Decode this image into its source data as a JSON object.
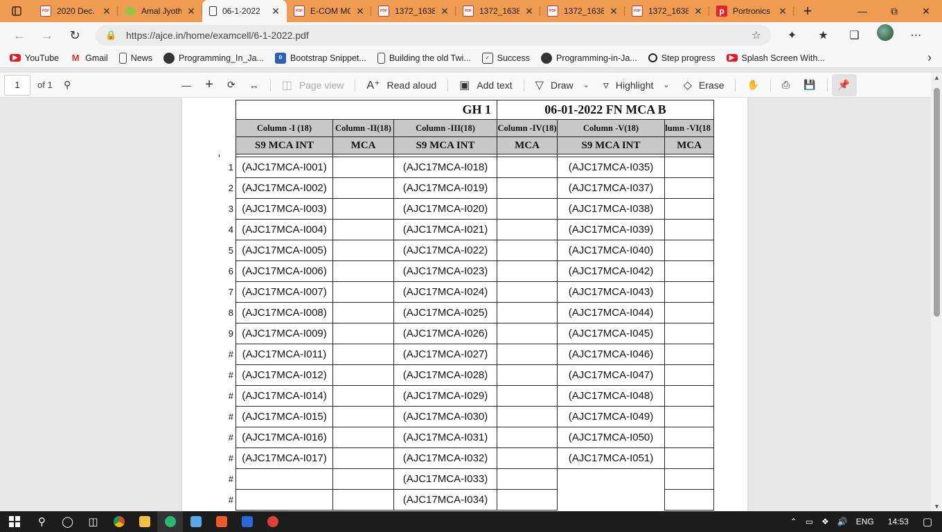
{
  "tabs": [
    {
      "title": "2020 Dec.",
      "fav": "PDF",
      "kind": "pdf"
    },
    {
      "title": "Amal Jyothi",
      "fav": "",
      "kind": "amal"
    },
    {
      "title": "06-1-2022",
      "fav": "",
      "kind": "page",
      "active": true
    },
    {
      "title": "E-COM MC",
      "fav": "PDF",
      "kind": "pdf"
    },
    {
      "title": "1372_1638",
      "fav": "PDF",
      "kind": "pdf"
    },
    {
      "title": "1372_1638",
      "fav": "PDF",
      "kind": "pdf"
    },
    {
      "title": "1372_1638",
      "fav": "PDF",
      "kind": "pdf"
    },
    {
      "title": "1372_1638",
      "fav": "PDF",
      "kind": "pdf"
    },
    {
      "title": "Portronics",
      "fav": "p",
      "kind": "port"
    }
  ],
  "address": {
    "url": "https://ajce.in/home/examcell/6-1-2022.pdf"
  },
  "bookmarks": [
    {
      "label": "YouTube",
      "icon": "youtube-icon"
    },
    {
      "label": "Gmail",
      "icon": "gmail-icon"
    },
    {
      "label": "News",
      "icon": "document-icon"
    },
    {
      "label": "Programming_In_Ja...",
      "icon": "github-icon"
    },
    {
      "label": "Bootstrap Snippet...",
      "icon": "bootstrap-icon"
    },
    {
      "label": "Building the old Twi...",
      "icon": "document-icon"
    },
    {
      "label": "Success",
      "icon": "okr-icon"
    },
    {
      "label": "Programming-in-Ja...",
      "icon": "github-icon"
    },
    {
      "label": "Step progress",
      "icon": "codepen-icon"
    },
    {
      "label": "Splash Screen With...",
      "icon": "youtube-icon"
    }
  ],
  "pdf_toolbar": {
    "page_number": "1",
    "page_count": "of 1",
    "page_view": "Page view",
    "read_aloud": "Read aloud",
    "add_text": "Add text",
    "draw": "Draw",
    "highlight": "Highlight",
    "erase": "Erase"
  },
  "sheet": {
    "gh": "GH 1",
    "session": "06-01-2022 FN MCA B",
    "columns": [
      "Column -I (18)",
      "Column -II(18)",
      "Column -III(18)",
      "Column -IV(18)",
      "Column -V(18)",
      "olumn -VI(18"
    ],
    "groups": [
      "S9 MCA INT",
      "MCA",
      "S9 MCA INT",
      "MCA",
      "S9 MCA INT",
      "MCA"
    ],
    "rows": [
      {
        "n": "1",
        "c1": "(AJC17MCA-I001)",
        "c3": "(AJC17MCA-I018)",
        "c5": "(AJC17MCA-I035)"
      },
      {
        "n": "2",
        "c1": "(AJC17MCA-I002)",
        "c3": "(AJC17MCA-I019)",
        "c5": "(AJC17MCA-I037)"
      },
      {
        "n": "3",
        "c1": "(AJC17MCA-I003)",
        "c3": "(AJC17MCA-I020)",
        "c5": "(AJC17MCA-I038)"
      },
      {
        "n": "4",
        "c1": "(AJC17MCA-I004)",
        "c3": "(AJC17MCA-I021)",
        "c5": "(AJC17MCA-I039)"
      },
      {
        "n": "5",
        "c1": "(AJC17MCA-I005)",
        "c3": "(AJC17MCA-I022)",
        "c5": "(AJC17MCA-I040)"
      },
      {
        "n": "6",
        "c1": "(AJC17MCA-I006)",
        "c3": "(AJC17MCA-I023)",
        "c5": "(AJC17MCA-I042)"
      },
      {
        "n": "7",
        "c1": "(AJC17MCA-I007)",
        "c3": "(AJC17MCA-I024)",
        "c5": "(AJC17MCA-I043)"
      },
      {
        "n": "8",
        "c1": "(AJC17MCA-I008)",
        "c3": "(AJC17MCA-I025)",
        "c5": "(AJC17MCA-I044)"
      },
      {
        "n": "9",
        "c1": "(AJC17MCA-I009)",
        "c3": "(AJC17MCA-I026)",
        "c5": "(AJC17MCA-I045)"
      },
      {
        "n": "#",
        "c1": "(AJC17MCA-I011)",
        "c3": "(AJC17MCA-I027)",
        "c5": "(AJC17MCA-I046)"
      },
      {
        "n": "#",
        "c1": "(AJC17MCA-I012)",
        "c3": "(AJC17MCA-I028)",
        "c5": "(AJC17MCA-I047)"
      },
      {
        "n": "#",
        "c1": "(AJC17MCA-I014)",
        "c3": "(AJC17MCA-I029)",
        "c5": "(AJC17MCA-I048)"
      },
      {
        "n": "#",
        "c1": "(AJC17MCA-I015)",
        "c3": "(AJC17MCA-I030)",
        "c5": "(AJC17MCA-I049)"
      },
      {
        "n": "#",
        "c1": "(AJC17MCA-I016)",
        "c3": "(AJC17MCA-I031)",
        "c5": "(AJC17MCA-I050)"
      },
      {
        "n": "#",
        "c1": "(AJC17MCA-I017)",
        "c3": "(AJC17MCA-I032)",
        "c5": "(AJC17MCA-I051)"
      },
      {
        "n": "#",
        "c1": "",
        "c3": "(AJC17MCA-I033)",
        "c5": ""
      },
      {
        "n": "#",
        "c1": "",
        "c3": "(AJC17MCA-I034)",
        "c5": ""
      }
    ]
  },
  "taskbar": {
    "lang": "ENG",
    "time": "14:53"
  },
  "colors": {
    "tabstrip": "#ef9b52",
    "header_fill": "#c8c8c8"
  }
}
